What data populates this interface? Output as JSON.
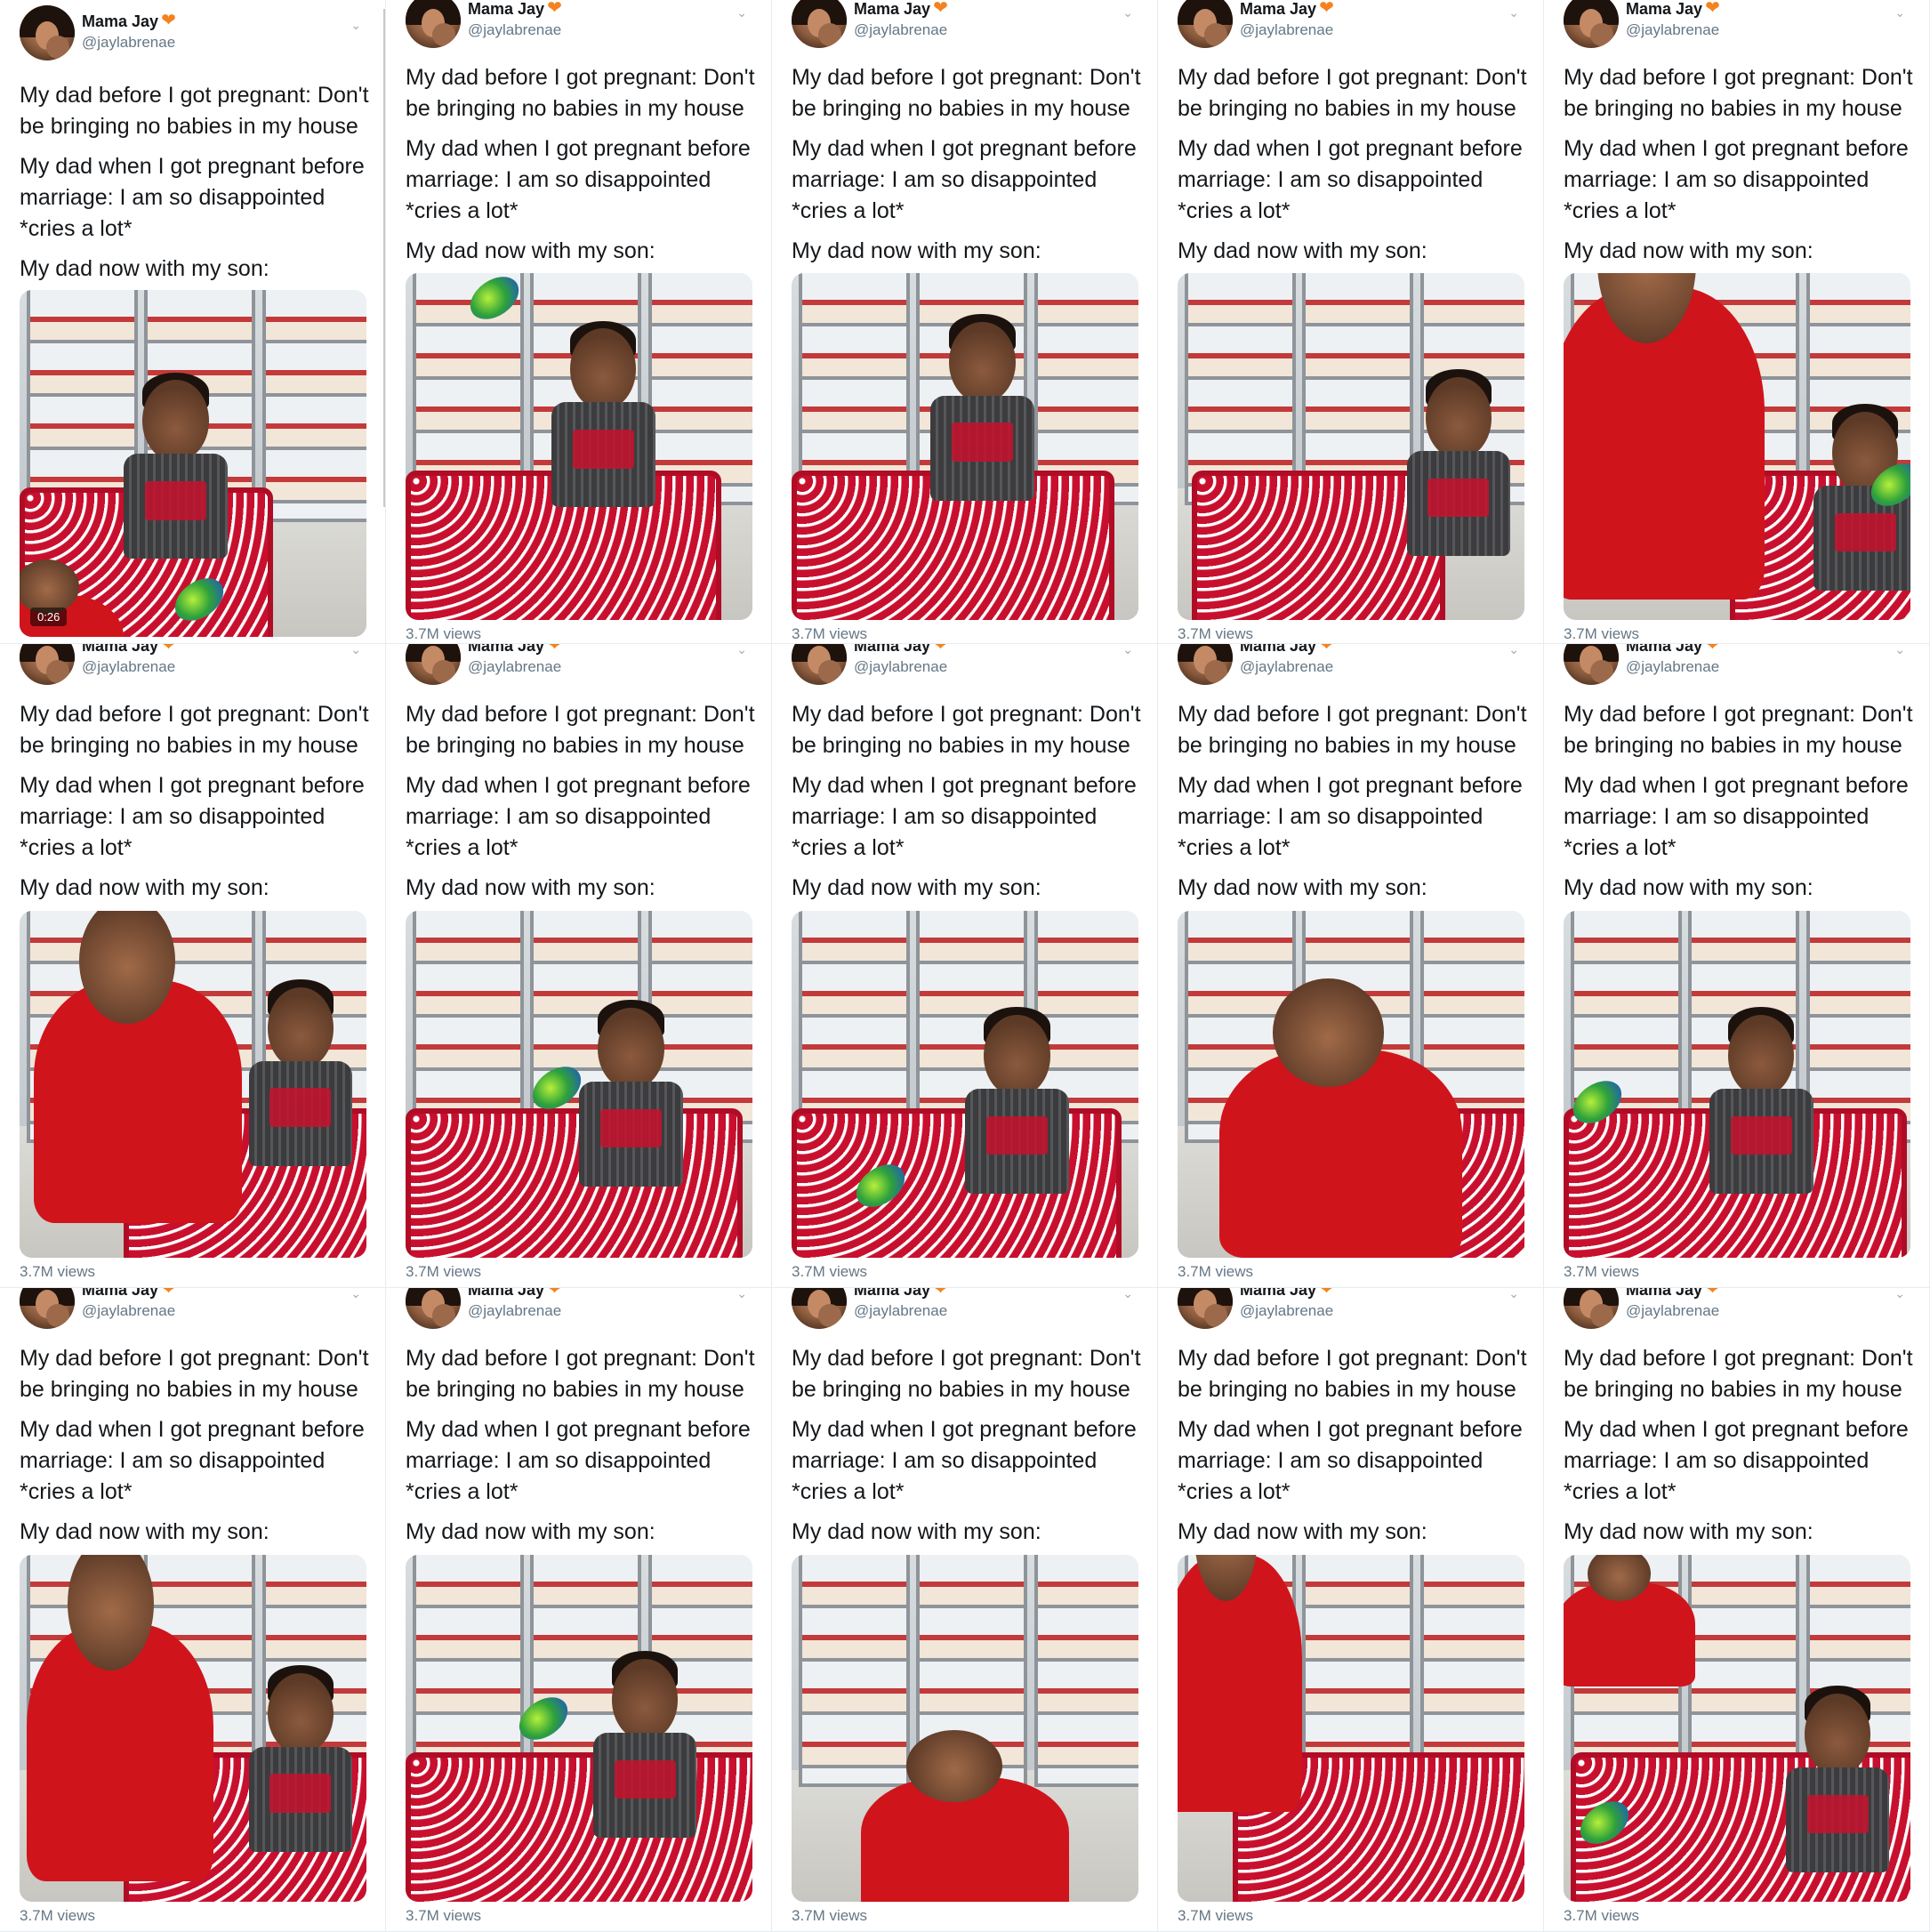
{
  "author": {
    "name": "Mama Jay",
    "handle": "@jaylabrenae",
    "badge_icon": "orange-heart-icon",
    "badge_color": "#f5821f"
  },
  "tweet": {
    "line1": "My dad before I got pregnant: Don't be bringing no babies in my house",
    "line2": "My dad when I got pregnant before marriage: I am so disappointed *cries a lot*",
    "line3": "My dad now with my son:"
  },
  "panels": [
    {
      "timestamp": "0:26",
      "views": ""
    },
    {
      "timestamp": "",
      "views": "3.7M views"
    },
    {
      "timestamp": "",
      "views": "3.7M views"
    },
    {
      "timestamp": "",
      "views": "3.7M views"
    },
    {
      "timestamp": "",
      "views": "3.7M views"
    },
    {
      "timestamp": "",
      "views": "3.7M views"
    },
    {
      "timestamp": "",
      "views": "3.7M views"
    },
    {
      "timestamp": "",
      "views": "3.7M views"
    },
    {
      "timestamp": "",
      "views": "3.7M views"
    },
    {
      "timestamp": "",
      "views": "3.7M views"
    },
    {
      "timestamp": "",
      "views": "3.7M views"
    },
    {
      "timestamp": "",
      "views": "3.7M views"
    },
    {
      "timestamp": "",
      "views": "3.7M views"
    },
    {
      "timestamp": "",
      "views": "3.7M views"
    },
    {
      "timestamp": "",
      "views": "3.7M views"
    }
  ],
  "colors": {
    "cart_red": "#c8102e",
    "shirt_red": "#d0141c",
    "text": "#14171a",
    "muted": "#657786"
  }
}
